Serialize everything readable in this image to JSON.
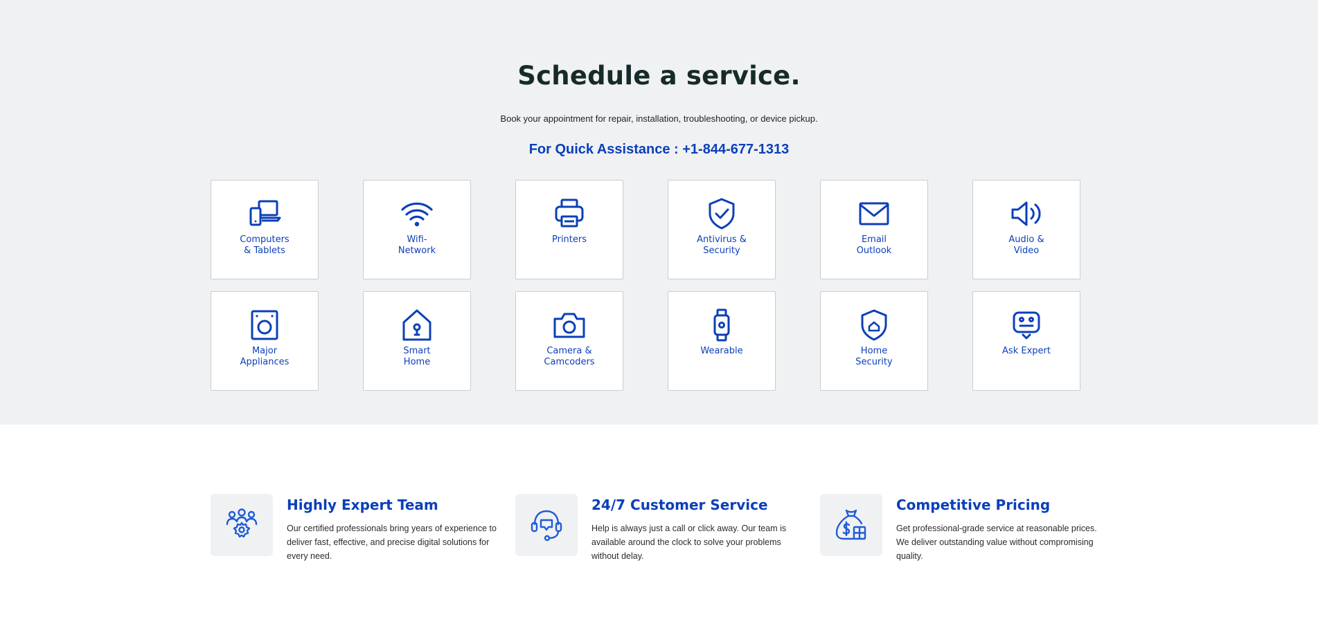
{
  "hero": {
    "title": "Schedule a service.",
    "subtitle": "Book your appointment for repair, installation, troubleshooting, or device pickup.",
    "phone_line": "For Quick Assistance : +1-844-677-1313"
  },
  "colors": {
    "accent": "#0b3fb9",
    "hero_bg": "#f0f1f3",
    "heading": "#172a2a"
  },
  "services": [
    {
      "label": "Computers\n& Tablets",
      "icon": "devices-icon"
    },
    {
      "label": "Wifi-\nNetwork",
      "icon": "wifi-icon"
    },
    {
      "label": "Printers",
      "icon": "printer-icon"
    },
    {
      "label": "Antivirus &\nSecurity",
      "icon": "shield-check-icon"
    },
    {
      "label": "Email\nOutlook",
      "icon": "envelope-icon"
    },
    {
      "label": "Audio &\nVideo",
      "icon": "speaker-icon"
    },
    {
      "label": "Major\nAppliances",
      "icon": "washer-icon"
    },
    {
      "label": "Smart\nHome",
      "icon": "smart-home-icon"
    },
    {
      "label": "Camera &\nCamcoders",
      "icon": "camera-icon"
    },
    {
      "label": "Wearable",
      "icon": "smartwatch-icon"
    },
    {
      "label": "Home\nSecurity",
      "icon": "home-shield-icon"
    },
    {
      "label": "Ask Expert",
      "icon": "robot-chat-icon"
    }
  ],
  "features": [
    {
      "title": "Highly Expert Team",
      "text": "Our certified professionals bring years of experience to deliver fast, effective, and precise digital solutions for every need.",
      "icon": "team-gear-icon"
    },
    {
      "title": "24/7 Customer Service",
      "text": "Help is always just a call or click away. Our team is available around the clock to solve your problems without delay.",
      "icon": "headset-icon"
    },
    {
      "title": "Competitive Pricing",
      "text": "Get professional-grade service at reasonable prices. We deliver outstanding value without compromising quality.",
      "icon": "money-bag-icon"
    }
  ]
}
